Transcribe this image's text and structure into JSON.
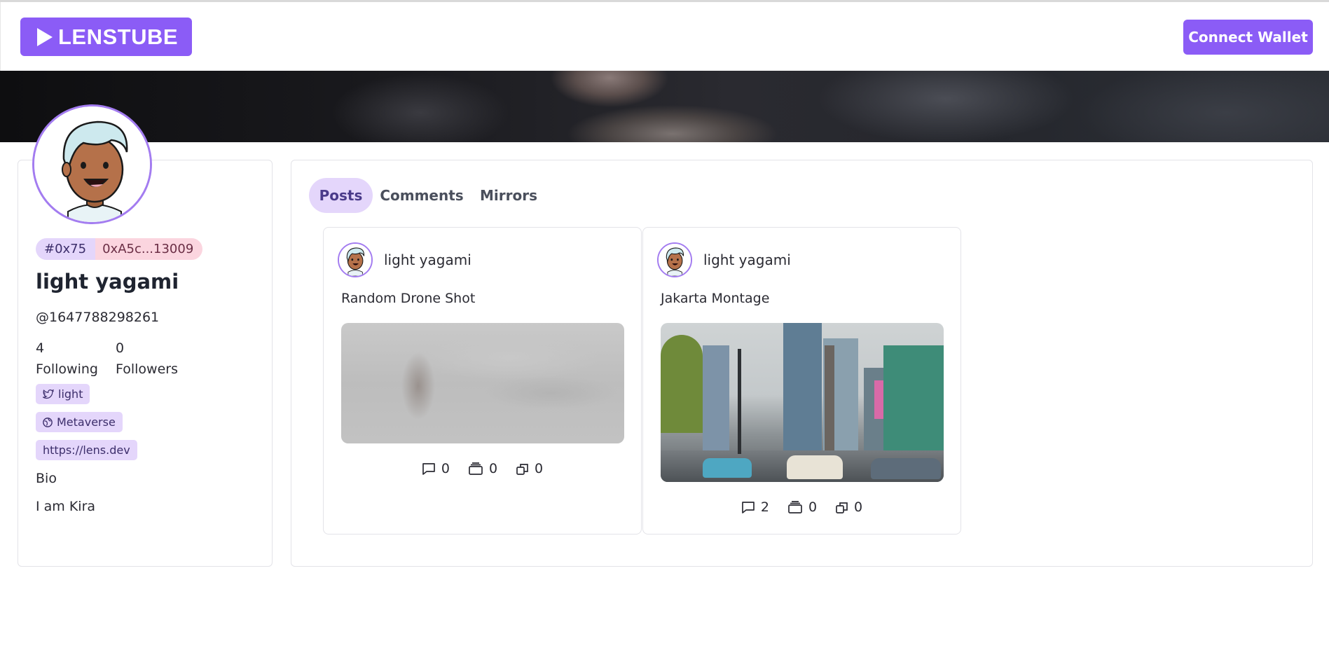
{
  "header": {
    "logo_text": "LENSTUBE",
    "connect_label": "Connect Wallet"
  },
  "profile": {
    "id_chip": "#0x75",
    "address_chip": "0xA5c...13009",
    "name": "light yagami",
    "handle": "@1647788298261",
    "following_count": "4",
    "following_label": "Following",
    "followers_count": "0",
    "followers_label": "Followers",
    "twitter": "light",
    "location": "Metaverse",
    "website": "https://lens.dev",
    "bio_label": "Bio",
    "bio": "I am Kira"
  },
  "tabs": [
    {
      "label": "Posts",
      "active": true
    },
    {
      "label": "Comments",
      "active": false
    },
    {
      "label": "Mirrors",
      "active": false
    }
  ],
  "posts": [
    {
      "author": "light yagami",
      "title": "Random Drone Shot",
      "comments": "0",
      "collects": "0",
      "mirrors": "0"
    },
    {
      "author": "light yagami",
      "title": "Jakarta Montage",
      "comments": "2",
      "collects": "0",
      "mirrors": "0"
    }
  ],
  "colors": {
    "accent": "#8b5cf6",
    "chip_purple": "#e4d6fb",
    "chip_pink": "#fbd5df"
  }
}
